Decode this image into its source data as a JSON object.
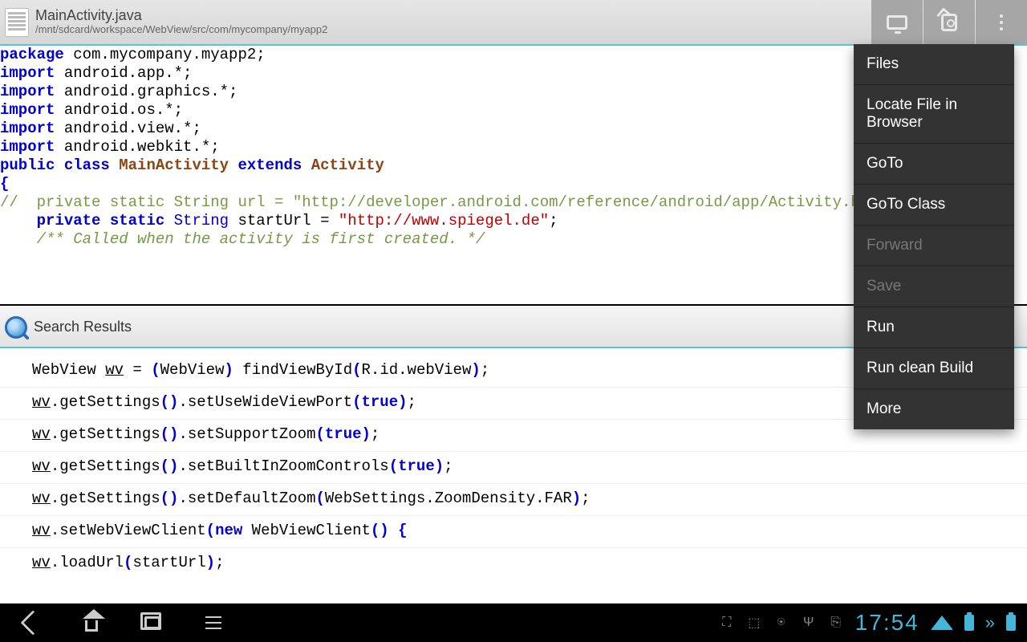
{
  "header": {
    "filename": "MainActivity.java",
    "filepath": "/mnt/sdcard/workspace/WebView/src/com/mycompany/myapp2"
  },
  "menu": {
    "items": [
      {
        "label": "Files",
        "disabled": false
      },
      {
        "label": "Locate File in Browser",
        "disabled": false
      },
      {
        "label": "GoTo",
        "disabled": false
      },
      {
        "label": "GoTo Class",
        "disabled": false
      },
      {
        "label": "Forward",
        "disabled": true
      },
      {
        "label": "Save",
        "disabled": true
      },
      {
        "label": "Run",
        "disabled": false
      },
      {
        "label": "Run clean Build",
        "disabled": false
      },
      {
        "label": "More",
        "disabled": false
      }
    ]
  },
  "search": {
    "label": "Search Results"
  },
  "code_top": {
    "lines": [
      [
        {
          "t": "package ",
          "c": "kw"
        },
        {
          "t": "com.mycompany.myapp2;",
          "c": ""
        }
      ],
      [
        {
          "t": "",
          "c": ""
        }
      ],
      [
        {
          "t": "import ",
          "c": "kw"
        },
        {
          "t": "android.app.*;",
          "c": ""
        }
      ],
      [
        {
          "t": "import ",
          "c": "kw"
        },
        {
          "t": "android.graphics.*;",
          "c": ""
        }
      ],
      [
        {
          "t": "import ",
          "c": "kw"
        },
        {
          "t": "android.os.*;",
          "c": ""
        }
      ],
      [
        {
          "t": "import ",
          "c": "kw"
        },
        {
          "t": "android.view.*;",
          "c": ""
        }
      ],
      [
        {
          "t": "import ",
          "c": "kw"
        },
        {
          "t": "android.webkit.*;",
          "c": ""
        }
      ],
      [
        {
          "t": "",
          "c": ""
        }
      ],
      [
        {
          "t": "public class ",
          "c": "kw"
        },
        {
          "t": "MainActivity",
          "c": "cls"
        },
        {
          "t": " extends ",
          "c": "kw"
        },
        {
          "t": "Activity",
          "c": "cls"
        }
      ],
      [
        {
          "t": "{",
          "c": "brace"
        }
      ],
      [
        {
          "t": "//  private static String url = \"http://developer.android.com/reference/android/app/Activity.html\";",
          "c": "cmt"
        }
      ],
      [
        {
          "t": "    ",
          "c": ""
        },
        {
          "t": "private static ",
          "c": "kw"
        },
        {
          "t": "String ",
          "c": "type"
        },
        {
          "t": "startUrl = ",
          "c": ""
        },
        {
          "t": "\"http://www.spiegel.de\"",
          "c": "str"
        },
        {
          "t": ";",
          "c": ""
        }
      ],
      [
        {
          "t": "",
          "c": ""
        }
      ],
      [
        {
          "t": "    ",
          "c": ""
        },
        {
          "t": "/** Called when the activity is first created. */",
          "c": "cmtd"
        }
      ]
    ]
  },
  "results": {
    "rows": [
      [
        {
          "t": "WebView ",
          "c": ""
        },
        {
          "t": "wv",
          "c": "tok"
        },
        {
          "t": " = ",
          "c": ""
        },
        {
          "t": "(",
          "c": "brace"
        },
        {
          "t": "WebView",
          "c": ""
        },
        {
          "t": ")",
          "c": "brace"
        },
        {
          "t": " findViewById",
          "c": ""
        },
        {
          "t": "(",
          "c": "brace"
        },
        {
          "t": "R.id.webView",
          "c": ""
        },
        {
          "t": ")",
          "c": "brace"
        },
        {
          "t": ";",
          "c": ""
        }
      ],
      [
        {
          "t": "wv",
          "c": "tok"
        },
        {
          "t": ".getSettings",
          "c": ""
        },
        {
          "t": "()",
          "c": "brace"
        },
        {
          "t": ".setUseWideViewPort",
          "c": ""
        },
        {
          "t": "(",
          "c": "brace"
        },
        {
          "t": "true",
          "c": "kw"
        },
        {
          "t": ")",
          "c": "brace"
        },
        {
          "t": ";",
          "c": ""
        }
      ],
      [
        {
          "t": "wv",
          "c": "tok"
        },
        {
          "t": ".getSettings",
          "c": ""
        },
        {
          "t": "()",
          "c": "brace"
        },
        {
          "t": ".setSupportZoom",
          "c": ""
        },
        {
          "t": "(",
          "c": "brace"
        },
        {
          "t": "true",
          "c": "kw"
        },
        {
          "t": ")",
          "c": "brace"
        },
        {
          "t": ";",
          "c": ""
        }
      ],
      [
        {
          "t": "wv",
          "c": "tok"
        },
        {
          "t": ".getSettings",
          "c": ""
        },
        {
          "t": "()",
          "c": "brace"
        },
        {
          "t": ".setBuiltInZoomControls",
          "c": ""
        },
        {
          "t": "(",
          "c": "brace"
        },
        {
          "t": "true",
          "c": "kw"
        },
        {
          "t": ")",
          "c": "brace"
        },
        {
          "t": ";",
          "c": ""
        }
      ],
      [
        {
          "t": "wv",
          "c": "tok"
        },
        {
          "t": ".getSettings",
          "c": ""
        },
        {
          "t": "()",
          "c": "brace"
        },
        {
          "t": ".setDefaultZoom",
          "c": ""
        },
        {
          "t": "(",
          "c": "brace"
        },
        {
          "t": "WebSettings.ZoomDensity.FAR",
          "c": ""
        },
        {
          "t": ")",
          "c": "brace"
        },
        {
          "t": ";",
          "c": ""
        }
      ],
      [
        {
          "t": "wv",
          "c": "tok"
        },
        {
          "t": ".setWebViewClient",
          "c": ""
        },
        {
          "t": "(",
          "c": "brace"
        },
        {
          "t": "new ",
          "c": "kw"
        },
        {
          "t": "WebViewClient",
          "c": ""
        },
        {
          "t": "()",
          "c": "brace"
        },
        {
          "t": " ",
          "c": ""
        },
        {
          "t": "{",
          "c": "brace"
        }
      ],
      [
        {
          "t": "wv",
          "c": "tok"
        },
        {
          "t": ".loadUrl",
          "c": ""
        },
        {
          "t": "(",
          "c": "brace"
        },
        {
          "t": "startUrl",
          "c": ""
        },
        {
          "t": ")",
          "c": "brace"
        },
        {
          "t": ";",
          "c": ""
        }
      ]
    ]
  },
  "sysbar": {
    "clock": "17:54"
  }
}
